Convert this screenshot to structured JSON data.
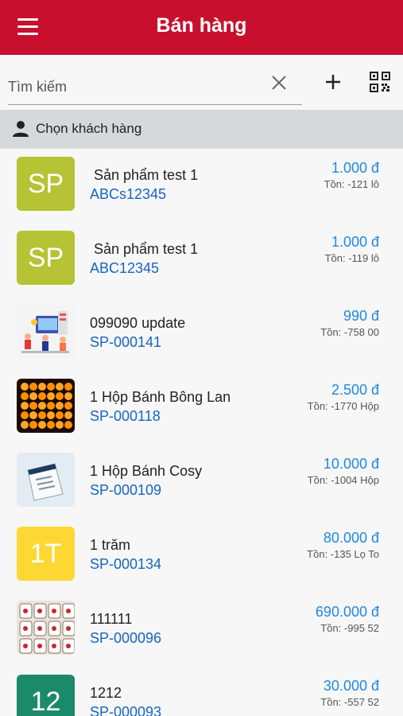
{
  "header": {
    "title": "Bán hàng"
  },
  "search": {
    "placeholder": "Tìm kiếm"
  },
  "customer": {
    "label": "Chọn khách hàng"
  },
  "products": [
    {
      "thumb_type": "initials",
      "initials": "SP",
      "color": "#b5c334",
      "name": " Sản phẩm test 1",
      "code": "ABCs12345",
      "price": "1.000 đ",
      "stock": "Tồn: -121 lô"
    },
    {
      "thumb_type": "initials",
      "initials": "SP",
      "color": "#b5c334",
      "name": " Sản phẩm test 1",
      "code": "ABC12345",
      "price": "1.000 đ",
      "stock": "Tồn: -119 lô"
    },
    {
      "thumb_type": "image",
      "image_name": "business-people-illustration",
      "name": "099090 update",
      "code": "SP-000141",
      "price": "990 đ",
      "stock": "Tồn: -758 00"
    },
    {
      "thumb_type": "image",
      "image_name": "glowing-cakes-photo",
      "name": "1 Hộp Bánh Bông Lan",
      "code": "SP-000118",
      "price": "2.500 đ",
      "stock": "Tồn: -1770 Hộp"
    },
    {
      "thumb_type": "image",
      "image_name": "cosy-box-photo",
      "name": "1 Hộp Bánh Cosy",
      "code": "SP-000109",
      "price": "10.000 đ",
      "stock": "Tồn: -1004 Hộp"
    },
    {
      "thumb_type": "initials",
      "initials": "1T",
      "color": "#fdd835",
      "name": "1 trăm",
      "code": "SP-000134",
      "price": "80.000 đ",
      "stock": "Tồn: -135 Lọ To"
    },
    {
      "thumb_type": "image",
      "image_name": "ceramic-cups-photo",
      "name": "111111",
      "code": "SP-000096",
      "price": "690.000 đ",
      "stock": "Tồn: -995 52"
    },
    {
      "thumb_type": "initials",
      "initials": "12",
      "color": "#1b8a6b",
      "name": "1212",
      "code": "SP-000093",
      "price": "30.000 đ",
      "stock": "Tồn: -557 52"
    }
  ]
}
